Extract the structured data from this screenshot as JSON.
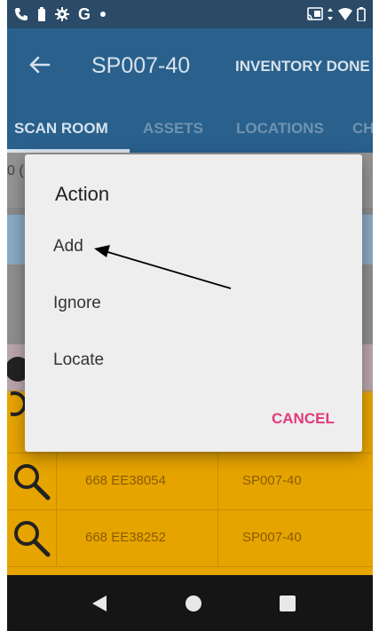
{
  "colors": {
    "primary": "#29608c",
    "status_bar": "#2a4a67",
    "accent_cancel": "#e3397a",
    "row_highlight": "#e6a400"
  },
  "status_bar": {
    "left_icons": [
      "phone-icon",
      "battery-small-icon",
      "gear-icon",
      "google-g-icon",
      "dot-icon"
    ],
    "google_letter": "G",
    "right_icons": [
      "cast-icon",
      "data-arrows-icon",
      "wifi-icon",
      "battery-icon"
    ]
  },
  "app_bar": {
    "back_icon": "arrow-back-icon",
    "title": "SP007-40",
    "action_label": "INVENTORY DONE"
  },
  "tabs": [
    {
      "label": "SCAN ROOM",
      "active": true
    },
    {
      "label": "ASSETS",
      "active": false
    },
    {
      "label": "LOCATIONS",
      "active": false
    },
    {
      "label": "CH",
      "active": false
    }
  ],
  "background": {
    "field_fragment": "0 (",
    "rows": [
      {
        "icon": "search-icon",
        "asset": "668 EE38054",
        "location": "SP007-40"
      },
      {
        "icon": "search-icon",
        "asset": "668 EE38252",
        "location": "SP007-40"
      }
    ]
  },
  "dialog": {
    "title": "Action",
    "items": [
      "Add",
      "Ignore",
      "Locate"
    ],
    "cancel_label": "CANCEL"
  },
  "nav_bar": {
    "icons": [
      "nav-back-icon",
      "nav-home-icon",
      "nav-recents-icon"
    ]
  }
}
